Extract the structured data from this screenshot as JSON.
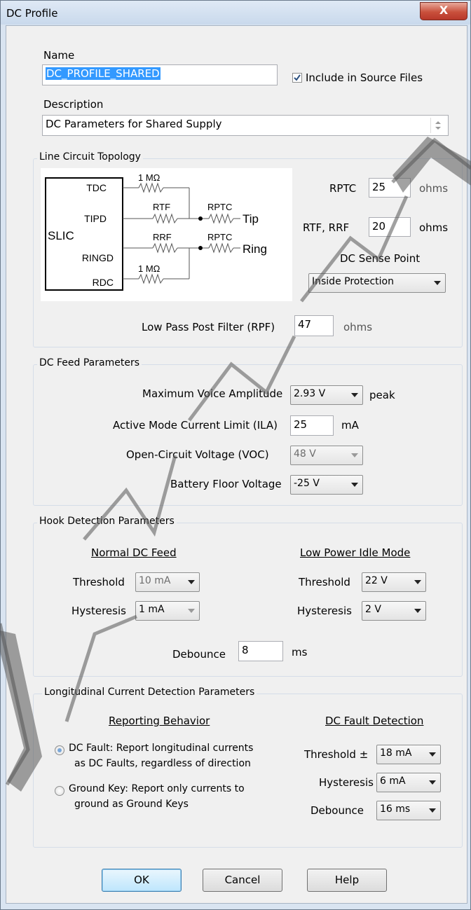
{
  "window": {
    "title": "DC Profile",
    "close_glyph": "X"
  },
  "name": {
    "label": "Name",
    "value": "DC_PROFILE_SHARED",
    "include_label": "Include in Source Files",
    "include_checked": true
  },
  "description": {
    "label": "Description",
    "value": "DC Parameters for Shared Supply"
  },
  "topology": {
    "group_label": "Line Circuit Topology",
    "diagram": {
      "slic": "SLIC",
      "tdc": "TDC",
      "tipd": "TIPD",
      "ringd": "RINGD",
      "rdc": "RDC",
      "r_top": "1 MΩ",
      "r_bottom": "1 MΩ",
      "rtf": "RTF",
      "rrf": "RRF",
      "rptc_tip": "RPTC",
      "rptc_ring": "RPTC",
      "tip": "Tip",
      "ring": "Ring"
    },
    "rptc_label": "RPTC",
    "rptc_value": "25",
    "rptc_unit": "ohms",
    "rtf_rrf_label": "RTF, RRF",
    "rtf_rrf_value": "20",
    "rtf_rrf_unit": "ohms",
    "sense_label": "DC Sense Point",
    "sense_value": "Inside Protection",
    "rpf_label": "Low Pass Post Filter (RPF)",
    "rpf_value": "47",
    "rpf_unit": "ohms"
  },
  "feed": {
    "group_label": "DC Feed Parameters",
    "max_voice_label": "Maximum Voice Amplitude",
    "max_voice_value": "2.93 V",
    "max_voice_unit": "peak",
    "ila_label": "Active Mode Current Limit (ILA)",
    "ila_value": "25",
    "ila_unit": "mA",
    "voc_label": "Open-Circuit Voltage (VOC)",
    "voc_value": "48 V",
    "battery_label": "Battery Floor Voltage",
    "battery_value": "-25 V"
  },
  "hook": {
    "group_label": "Hook Detection Parameters",
    "normal_header": "Normal DC Feed",
    "lowpower_header": "Low Power Idle Mode",
    "threshold_label": "Threshold",
    "hysteresis_label": "Hysteresis",
    "normal_threshold": "10 mA",
    "normal_hysteresis": "1 mA",
    "lp_threshold": "22 V",
    "lp_hysteresis": "2 V",
    "debounce_label": "Debounce",
    "debounce_value": "8",
    "debounce_unit": "ms"
  },
  "longitudinal": {
    "group_label": "Longitudinal Current Detection Parameters",
    "reporting_header": "Reporting Behavior",
    "fault_header": "DC Fault Detection",
    "opt1_line1": "DC Fault: Report longitudinal currents",
    "opt1_line2": "as DC Faults, regardless of direction",
    "opt2_line1": "Ground Key: Report only currents to",
    "opt2_line2": "ground as Ground Keys",
    "selected": 1,
    "threshold_label": "Threshold ±",
    "threshold_value": "18 mA",
    "hysteresis_label": "Hysteresis",
    "hysteresis_value": "6 mA",
    "debounce_label": "Debounce",
    "debounce_value": "16 ms"
  },
  "buttons": {
    "ok": "OK",
    "cancel": "Cancel",
    "help": "Help"
  },
  "colors": {
    "title_bg": "#d3e1f1",
    "close_red": "#c9503c",
    "default_button": "#bee6fd"
  }
}
